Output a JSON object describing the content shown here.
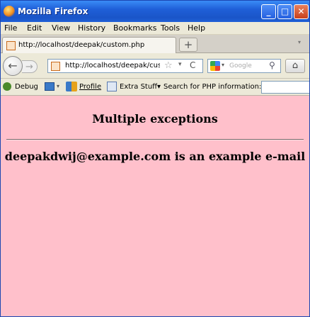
{
  "window": {
    "title": "Mozilla Firefox",
    "controls": {
      "minimize": "_",
      "maximize": "□",
      "close": "✕"
    }
  },
  "menu": {
    "items": [
      "File",
      "Edit",
      "View",
      "History",
      "Bookmarks",
      "Tools",
      "Help"
    ]
  },
  "tabs": {
    "items": [
      {
        "label": "http://localhost/deepak/custom.php",
        "icon": "page-favicon"
      }
    ],
    "new_tab": "+",
    "list_arrow": "▾"
  },
  "navigation": {
    "back": "←",
    "forward": "→",
    "url": "http://localhost/deepak/cus",
    "bookmark_star": "☆",
    "history_dropdown": "▾",
    "reload": "C",
    "search_engine": "google-icon",
    "search_placeholder": "Google",
    "search_button": "⚲",
    "home": "⌂"
  },
  "toolbar": {
    "debug": "Debug",
    "profile": "Profile",
    "extra_stuff": "Extra Stuff",
    "extra_stuff_arrow": "▾",
    "php_search_label": "Search for PHP information:",
    "php_search_value": ""
  },
  "page": {
    "heading": "Multiple exceptions",
    "message": "deepakdwij@example.com is an example e-mail",
    "background": "#ffc0cb"
  }
}
